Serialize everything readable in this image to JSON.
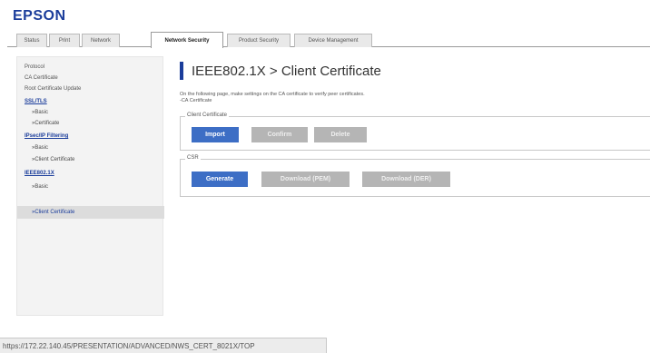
{
  "app": {
    "logo": "EPSON"
  },
  "tabs": [
    {
      "label": "Status"
    },
    {
      "label": "Print"
    },
    {
      "label": "Network"
    },
    {
      "label": "Network Security",
      "active": true
    },
    {
      "label": "Product Security"
    },
    {
      "label": "Device Management"
    }
  ],
  "sidebar": {
    "items": [
      {
        "label": "Protocol"
      },
      {
        "label": "CA Certificate"
      },
      {
        "label": "Root Certificate Update"
      },
      {
        "label": "SSL/TLS"
      },
      {
        "label": "»Basic"
      },
      {
        "label": "»Certificate"
      },
      {
        "label": "IPsec/IP Filtering"
      },
      {
        "label": "»Basic"
      },
      {
        "label": "»Client Certificate"
      },
      {
        "label": "IEEE802.1X"
      },
      {
        "label": "»Basic"
      },
      {
        "label": "»Client Certificate"
      }
    ]
  },
  "main": {
    "title": "IEEE802.1X > Client Certificate",
    "description_line1": "On the following page, make settings on the CA certificate to verify peer certificates.",
    "description_line2": "-CA Certificate",
    "client_certificate": {
      "legend": "Client Certificate",
      "import_label": "Import",
      "confirm_label": "Confirm",
      "delete_label": "Delete"
    },
    "csr": {
      "legend": "CSR",
      "generate_label": "Generate",
      "download_pem_label": "Download (PEM)",
      "download_der_label": "Download (DER)"
    }
  },
  "status_bar": {
    "url": "https://172.22.140.45/PRESENTATION/ADVANCED/NWS_CERT_8021X/TOP"
  },
  "colors": {
    "brand": "#1b3d9b",
    "primary_button": "#3d6ec5",
    "disabled_button": "#b5b5b5"
  }
}
